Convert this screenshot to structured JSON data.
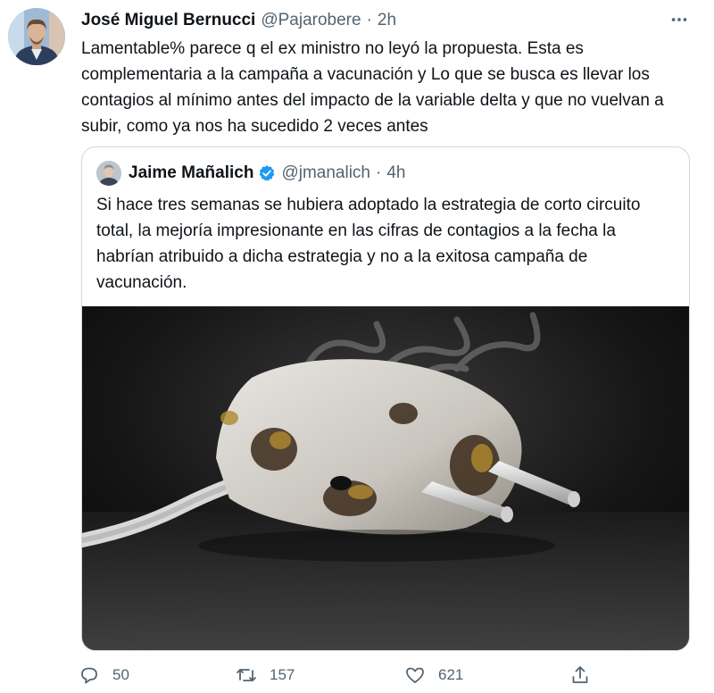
{
  "tweet": {
    "author_name": "José Miguel Bernucci",
    "handle": "@Pajarobere",
    "separator": "·",
    "time": "2h",
    "text": "Lamentable% parece q el ex ministro no leyó la propuesta. Esta es complementaria a la campaña a vacunación y Lo que se busca es llevar los contagios al mínimo antes del impacto de la variable delta y que no vuelvan a subir, como ya nos ha sucedido 2 veces antes"
  },
  "quoted_tweet": {
    "author_name": "Jaime Mañalich",
    "handle": "@jmanalich",
    "separator": "·",
    "time": "4h",
    "verified": true,
    "text": "Si hace tres semanas se hubiera adoptado la estrategia de corto circuito total, la mejoría impresionante en las cifras de contagios a la fecha la habrían atribuido a dicha estrategia y no a la exitosa campaña de vacunación.",
    "image": "burnt-electrical-plug-photo"
  },
  "actions": {
    "reply_count": "50",
    "retweet_count": "157",
    "like_count": "621"
  },
  "colors": {
    "text": "#0f1419",
    "muted": "#536471",
    "border": "#cfd9de",
    "verified_blue": "#1d9bf0"
  },
  "icons": [
    "more-icon",
    "verified-icon",
    "reply-icon",
    "retweet-icon",
    "like-icon",
    "share-icon"
  ]
}
